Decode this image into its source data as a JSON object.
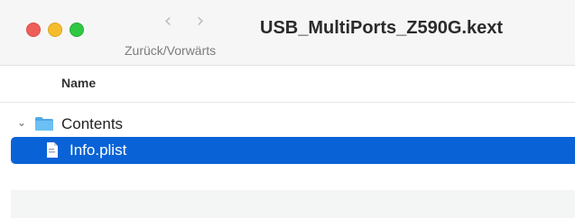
{
  "window": {
    "title": "USB_MultiPorts_Z590G.kext"
  },
  "traffic_lights": {
    "close_color": "#ee5f57",
    "minimize_color": "#f5bd2e",
    "zoom_color": "#2fc843"
  },
  "toolbar": {
    "back_icon": "chevron-left-icon",
    "forward_icon": "chevron-right-icon",
    "nav_label": "Zurück/Vorwärts"
  },
  "columns": {
    "name_header": "Name"
  },
  "rows": [
    {
      "label": "Contents",
      "kind": "folder",
      "icon": "folder-icon",
      "expanded": true,
      "selected": false
    },
    {
      "label": "Info.plist",
      "kind": "file",
      "icon": "document-icon",
      "selected": true
    }
  ],
  "colors": {
    "selection": "#0a63d6",
    "folder": "#5ab3ee"
  }
}
